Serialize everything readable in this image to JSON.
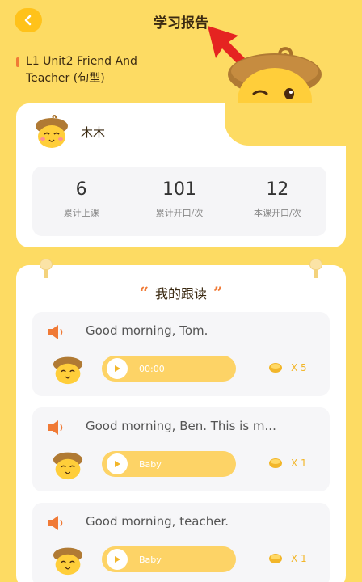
{
  "header": {
    "title": "学习报告",
    "back_icon": "back-icon"
  },
  "lesson": {
    "title": "L1 Unit2 Friend And Teacher (句型)"
  },
  "user": {
    "name": "木木",
    "avatar_icon": "acorn-avatar-icon"
  },
  "stats": [
    {
      "value": "6",
      "label": "累计上课"
    },
    {
      "value": "101",
      "label": "累计开口/次"
    },
    {
      "value": "12",
      "label": "本课开口/次"
    }
  ],
  "section": {
    "quote_open": "“",
    "title": "我的跟读",
    "quote_close": "”"
  },
  "recordings": [
    {
      "sentence": "Good morning, Tom.",
      "play_text": "00:00",
      "score": "X 5"
    },
    {
      "sentence": "Good morning, Ben. This is m...",
      "play_text": "Baby",
      "score": "X 1"
    },
    {
      "sentence": "Good morning, teacher.",
      "play_text": "Baby",
      "score": "X 1"
    }
  ],
  "colors": {
    "background": "#fddb63",
    "accent_orange": "#f07a36",
    "button_yellow": "#ffc21a",
    "pill_yellow": "#fdd366",
    "annotation_red": "#e52421"
  }
}
